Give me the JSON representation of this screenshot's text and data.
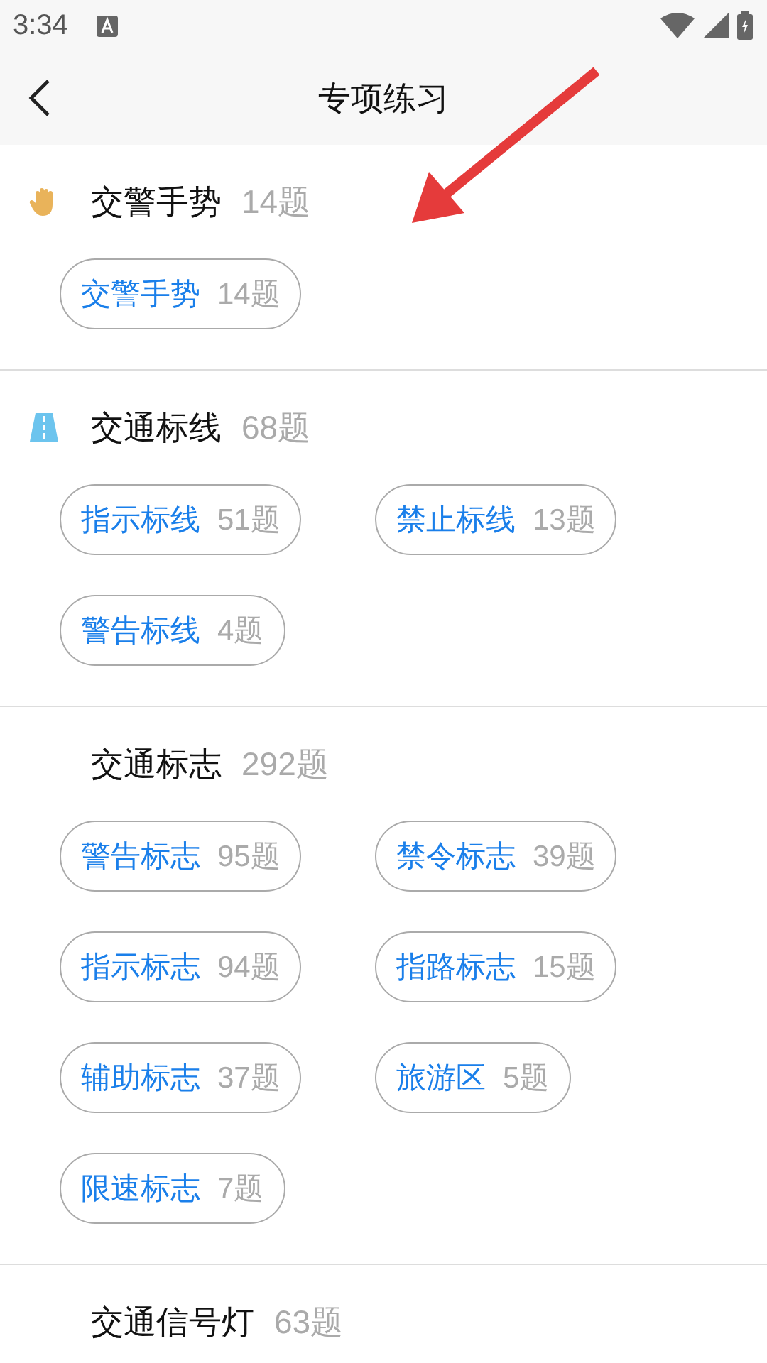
{
  "status_bar": {
    "time": "3:34"
  },
  "header": {
    "title": "专项练习"
  },
  "sections": [
    {
      "kind": "hand",
      "title": "交警手势",
      "count": "14题",
      "chips": [
        {
          "label": "交警手势",
          "count": "14题"
        }
      ]
    },
    {
      "kind": "road",
      "title": "交通标线",
      "count": "68题",
      "chips": [
        {
          "label": "指示标线",
          "count": "51题"
        },
        {
          "label": "禁止标线",
          "count": "13题"
        },
        {
          "label": "警告标线",
          "count": "4题"
        }
      ]
    },
    {
      "kind": "plain",
      "title": "交通标志",
      "count": "292题",
      "chips": [
        {
          "label": "警告标志",
          "count": "95题"
        },
        {
          "label": "禁令标志",
          "count": "39题"
        },
        {
          "label": "指示标志",
          "count": "94题"
        },
        {
          "label": "指路标志",
          "count": "15题"
        },
        {
          "label": "辅助标志",
          "count": "37题"
        },
        {
          "label": "旅游区",
          "count": "5题"
        },
        {
          "label": "限速标志",
          "count": "7题"
        }
      ]
    },
    {
      "kind": "plain",
      "title": "交通信号灯",
      "count": "63题"
    }
  ]
}
